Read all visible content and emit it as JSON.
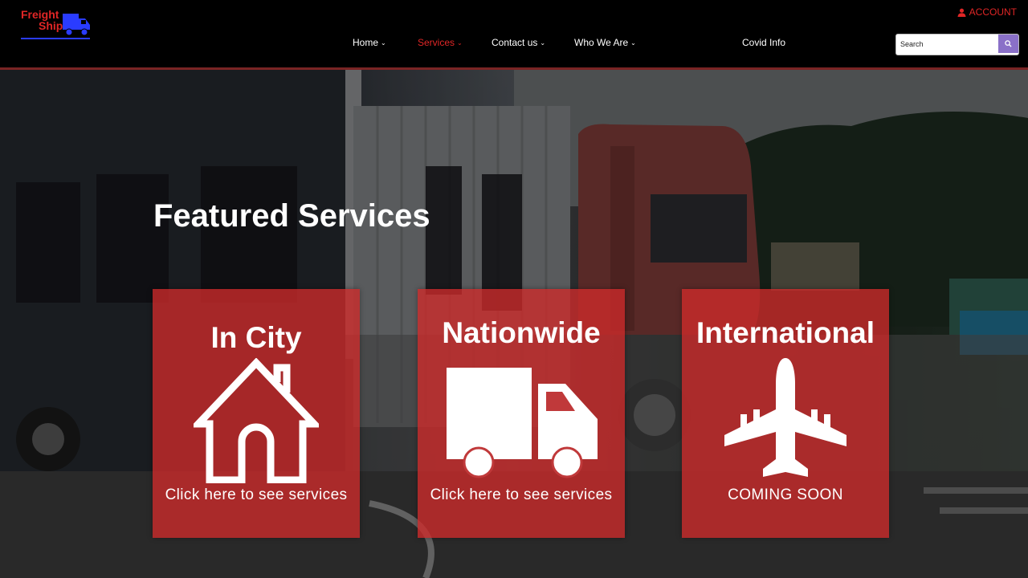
{
  "brand": {
    "line1": "Freight",
    "line2": "Ship",
    "logo_color": "#e02626",
    "truck_color": "#2a3cff"
  },
  "header": {
    "account_label": "ACCOUNT",
    "nav": [
      {
        "label": "Home",
        "active": false
      },
      {
        "label": "Services",
        "active": true
      },
      {
        "label": "Contact us",
        "active": false
      },
      {
        "label": "Who We Are",
        "active": false
      },
      {
        "label": "Covid Info",
        "active": false
      }
    ],
    "search": {
      "placeholder": "Search",
      "value": ""
    }
  },
  "colors": {
    "accent": "#e02626",
    "card": "#ce2a2a",
    "search_button": "#8a70c8"
  },
  "hero": {
    "title": "Featured Services",
    "cards": [
      {
        "title": "In City",
        "subtitle": "Click here to see services",
        "icon": "house-icon"
      },
      {
        "title": "Nationwide",
        "subtitle": "Click here to see services",
        "icon": "truck-icon"
      },
      {
        "title": "International",
        "subtitle": "COMING SOON",
        "icon": "airplane-icon"
      }
    ]
  }
}
